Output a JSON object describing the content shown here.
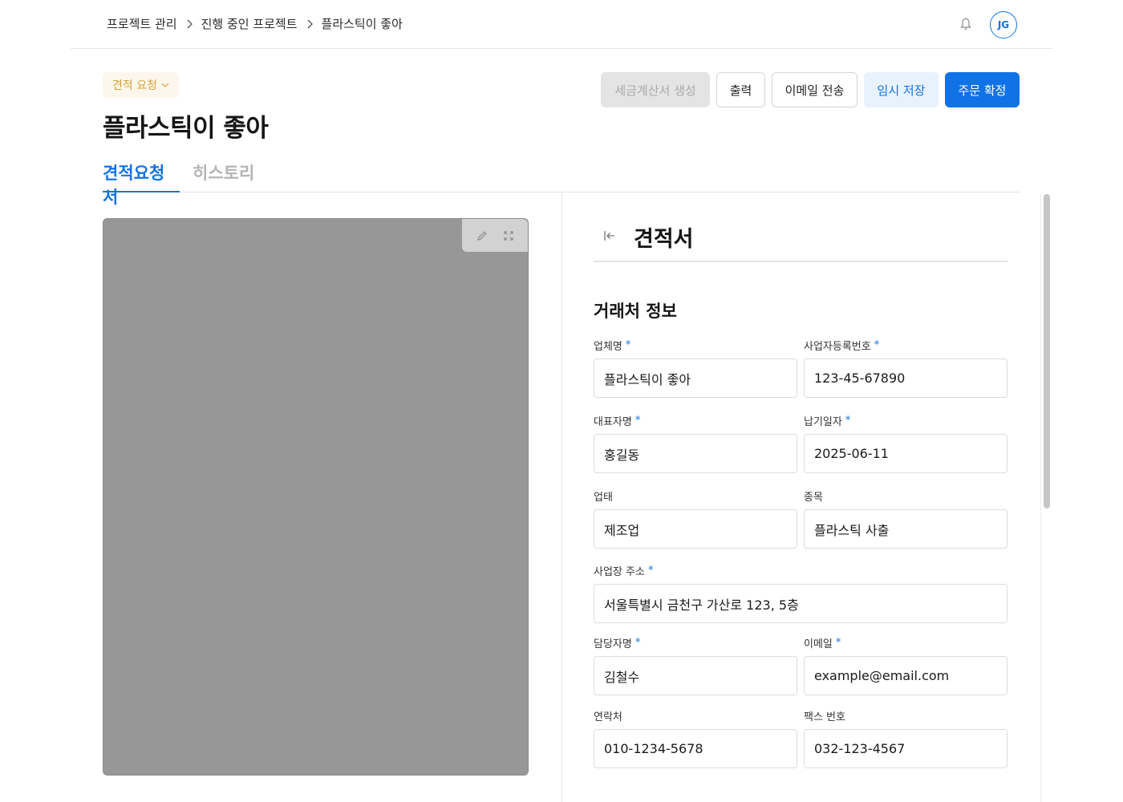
{
  "breadcrumb": [
    "프로젝트 관리",
    "진행 중인 프로젝트",
    "플라스틱이 좋아"
  ],
  "user": {
    "initials": "JG"
  },
  "status": {
    "label": "견적 요청"
  },
  "title": "플라스틱이 좋아",
  "actions": {
    "tax_invoice": "세금계산서 생성",
    "print": "출력",
    "send_email": "이메일 전송",
    "save_draft": "임시 저장",
    "confirm_order": "주문 확정"
  },
  "tabs": {
    "quote_request": "견적요청서",
    "history": "히스토리"
  },
  "panel": {
    "title": "견적서",
    "section_title": "거래처 정보"
  },
  "fields": {
    "company_name": {
      "label": "업체명",
      "value": "플라스틱이 좋아"
    },
    "business_number": {
      "label": "사업자등록번호",
      "value": "123-45-67890"
    },
    "representative": {
      "label": "대표자명",
      "value": "홍길동"
    },
    "due_date": {
      "label": "납기일자",
      "value": "2025-06-11"
    },
    "business_type": {
      "label": "업태",
      "value": "제조업"
    },
    "business_item": {
      "label": "종목",
      "value": "플라스틱 사출"
    },
    "address": {
      "label": "사업장 주소",
      "value": "서울특별시 금천구 가산로 123, 5층"
    },
    "manager": {
      "label": "담당자명",
      "value": "김철수"
    },
    "email": {
      "label": "이메일",
      "value": "example@email.com"
    },
    "phone": {
      "label": "연락처",
      "value": "010-1234-5678"
    },
    "fax": {
      "label": "팩스 번호",
      "value": "032-123-4567"
    }
  },
  "required_mark": "*",
  "colors": {
    "primary": "#1273e6",
    "status": "#d9a13a",
    "preview_bg": "#979797"
  }
}
